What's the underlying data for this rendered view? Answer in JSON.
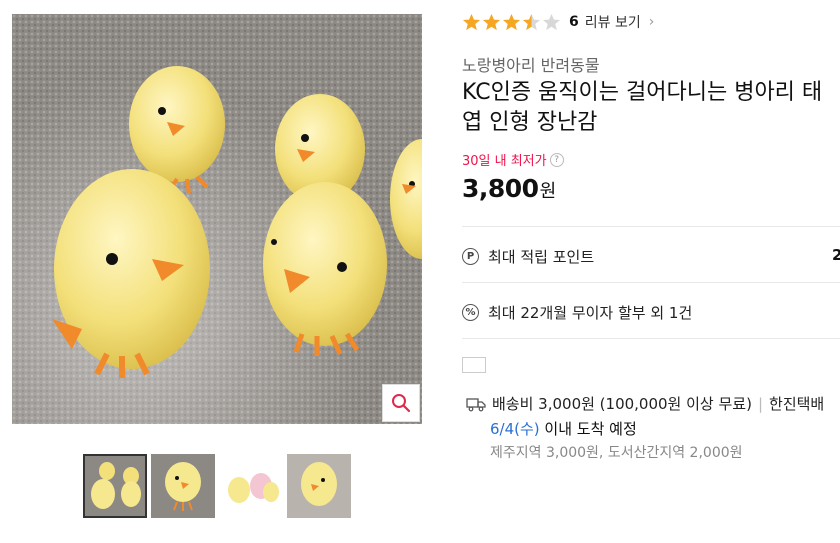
{
  "product_image": {
    "alt": "yellow chick toys"
  },
  "zoom": {
    "icon": "magnifier-icon"
  },
  "thumbnails": [
    {
      "name": "thumb-1",
      "active": true
    },
    {
      "name": "thumb-2",
      "active": false
    },
    {
      "name": "thumb-3",
      "active": false
    },
    {
      "name": "thumb-4",
      "active": false
    }
  ],
  "rating": {
    "score": 3.5,
    "max": 5,
    "count": "6",
    "label": "리뷰 보기",
    "chevron": "›"
  },
  "seller": "노랑병아리 반려동물",
  "title": "KC인증 움직이는 걸어다니는 병아리 태엽 인형 장난감",
  "lowest_label": "30일 내 최저가",
  "lowest_help": "?",
  "price": {
    "value": "3,800",
    "unit": "원"
  },
  "benefits": {
    "point": {
      "icon": "P",
      "label": "최대 적립 포인트",
      "value": "2"
    },
    "installment": {
      "icon": "%",
      "label": "최대 22개월 무이자 할부 외 1건"
    }
  },
  "shipping": {
    "fee": "배송비 3,000원 (100,000원 이상 무료)",
    "separator": "|",
    "carrier": "한진택배",
    "arrival_date": "6/4(수)",
    "arrival_text": " 이내 도착 예정",
    "extra": "제주지역 3,000원, 도서산간지역 2,000원"
  },
  "colors": {
    "star": "#f5a623",
    "lowest": "#f0134a",
    "date": "#2a6fd6"
  }
}
